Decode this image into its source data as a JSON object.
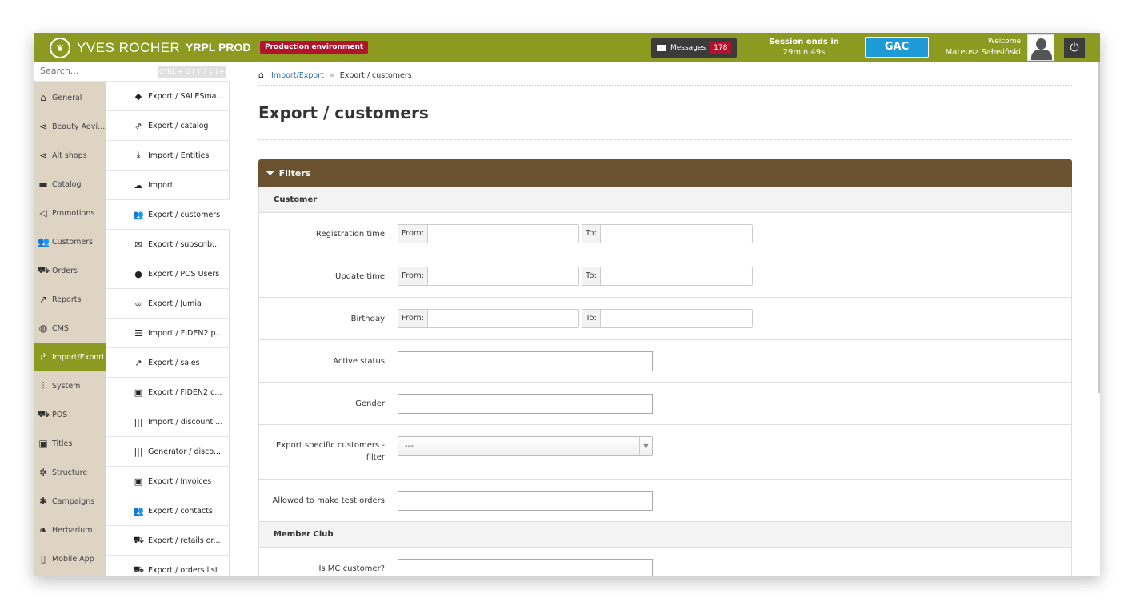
{
  "header": {
    "brand": "YVES ROCHER",
    "app_name": "YRPL PROD",
    "environment_badge": "Production environment",
    "messages_label": "Messages",
    "messages_count": "178",
    "session_title": "Session ends in",
    "session_time": "29min 49s",
    "gac_label": "GAC",
    "welcome_label": "Welcome",
    "user_name": "Mateusz Sałasiński"
  },
  "search": {
    "placeholder": "Search...",
    "shortcut_hint": "CTRL + Q | ↑ / ↓ | ↵"
  },
  "sidebar": {
    "items": [
      {
        "label": "General",
        "icon": "home-icon"
      },
      {
        "label": "Beauty Advi...",
        "icon": "share-icon"
      },
      {
        "label": "Alt shops",
        "icon": "share-icon"
      },
      {
        "label": "Catalog",
        "icon": "folder-icon"
      },
      {
        "label": "Promotions",
        "icon": "megaphone-icon"
      },
      {
        "label": "Customers",
        "icon": "users-icon"
      },
      {
        "label": "Orders",
        "icon": "cart-icon"
      },
      {
        "label": "Reports",
        "icon": "chart-icon"
      },
      {
        "label": "CMS",
        "icon": "globe-icon"
      },
      {
        "label": "Import/Export",
        "icon": "arrow-icon",
        "active": true
      },
      {
        "label": "System",
        "icon": "sliders-icon"
      },
      {
        "label": "POS",
        "icon": "cart-icon"
      },
      {
        "label": "Titles",
        "icon": "id-card-icon"
      },
      {
        "label": "Structure",
        "icon": "gear-icon"
      },
      {
        "label": "Campaigns",
        "icon": "asterisk-icon"
      },
      {
        "label": "Herbarium",
        "icon": "leaf-icon"
      },
      {
        "label": "Mobile App",
        "icon": "phone-icon"
      }
    ]
  },
  "subnav": {
    "items": [
      {
        "label": "Export / SALESma...",
        "icon": "tag-icon"
      },
      {
        "label": "Export / catalog",
        "icon": "export-icon"
      },
      {
        "label": "Import / Entities",
        "icon": "download-icon"
      },
      {
        "label": "Import",
        "icon": "cloud-icon"
      },
      {
        "label": "Export / customers",
        "icon": "users-icon",
        "active": true
      },
      {
        "label": "Export / subscrib...",
        "icon": "envelope-icon"
      },
      {
        "label": "Export / POS Users",
        "icon": "user-icon"
      },
      {
        "label": "Export / Jumia",
        "icon": "link-icon"
      },
      {
        "label": "Import / FIDEN2 p...",
        "icon": "list-icon"
      },
      {
        "label": "Export / sales",
        "icon": "chart-icon"
      },
      {
        "label": "Export / FIDEN2 c...",
        "icon": "id-card-icon"
      },
      {
        "label": "Import / discount ...",
        "icon": "barcode-icon"
      },
      {
        "label": "Generator / disco...",
        "icon": "barcode-icon"
      },
      {
        "label": "Export / Invoices",
        "icon": "id-card-icon"
      },
      {
        "label": "Export / contacts",
        "icon": "users-icon"
      },
      {
        "label": "Export / retails or...",
        "icon": "cart-icon"
      },
      {
        "label": "Export / orders list",
        "icon": "cart-icon"
      }
    ]
  },
  "breadcrumb": {
    "parent": "Import/Export",
    "separator": "»",
    "current": "Export / customers"
  },
  "page": {
    "title": "Export / customers",
    "filters_label": "Filters"
  },
  "sections": {
    "customer": "Customer",
    "member_club": "Member Club"
  },
  "fields": {
    "from_label": "From:",
    "to_label": "To:",
    "registration_time": "Registration time",
    "update_time": "Update time",
    "birthday": "Birthday",
    "active_status": "Active status",
    "gender": "Gender",
    "export_specific_line1": "Export specific customers -",
    "export_specific_line2": "filter",
    "export_specific_value": "---",
    "allowed_test_orders": "Allowed to make test orders",
    "is_mc_customer": "Is MC customer?"
  },
  "colors": {
    "topbar": "#8c9a22",
    "sidebar": "#ded4c4",
    "filters_header": "#6b5230",
    "badge_red": "#b3142d",
    "gac_blue": "#1e9ad6"
  }
}
